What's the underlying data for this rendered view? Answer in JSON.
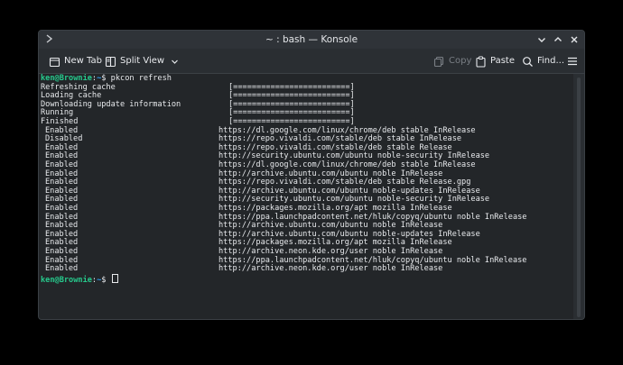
{
  "window": {
    "title": "~ : bash — Konsole"
  },
  "toolbar": {
    "new_tab_label": "New Tab",
    "split_view_label": "Split View",
    "copy_label": "Copy",
    "paste_label": "Paste",
    "find_label": "Find..."
  },
  "terminal": {
    "prompt_user": "ken@Brownie",
    "prompt_sep": ":",
    "prompt_path": "~",
    "prompt_symbol": "$",
    "command": "pkcon refresh",
    "progress_lines": [
      {
        "label": "Refreshing cache",
        "bar": "[=========================]"
      },
      {
        "label": "Loading cache",
        "bar": "[=========================]"
      },
      {
        "label": "Downloading update information",
        "bar": "[=========================]"
      },
      {
        "label": "Running",
        "bar": "[=========================]"
      },
      {
        "label": "Finished",
        "bar": "[=========================]"
      }
    ],
    "repo_lines": [
      {
        "status": "Enabled",
        "repo": "https://dl.google.com/linux/chrome/deb stable InRelease"
      },
      {
        "status": "Disabled",
        "repo": "https://repo.vivaldi.com/stable/deb stable InRelease"
      },
      {
        "status": "Enabled",
        "repo": "https://repo.vivaldi.com/stable/deb stable Release"
      },
      {
        "status": "Enabled",
        "repo": "http://security.ubuntu.com/ubuntu noble-security InRelease"
      },
      {
        "status": "Enabled",
        "repo": "https://dl.google.com/linux/chrome/deb stable InRelease"
      },
      {
        "status": "Enabled",
        "repo": "http://archive.ubuntu.com/ubuntu noble InRelease"
      },
      {
        "status": "Enabled",
        "repo": "https://repo.vivaldi.com/stable/deb stable Release.gpg"
      },
      {
        "status": "Enabled",
        "repo": "http://archive.ubuntu.com/ubuntu noble-updates InRelease"
      },
      {
        "status": "Enabled",
        "repo": "http://security.ubuntu.com/ubuntu noble-security InRelease"
      },
      {
        "status": "Enabled",
        "repo": "https://packages.mozilla.org/apt mozilla InRelease"
      },
      {
        "status": "Enabled",
        "repo": "https://ppa.launchpadcontent.net/hluk/copyq/ubuntu noble InRelease"
      },
      {
        "status": "Enabled",
        "repo": "http://archive.ubuntu.com/ubuntu noble InRelease"
      },
      {
        "status": "Enabled",
        "repo": "http://archive.ubuntu.com/ubuntu noble-updates InRelease"
      },
      {
        "status": "Enabled",
        "repo": "https://packages.mozilla.org/apt mozilla InRelease"
      },
      {
        "status": "Enabled",
        "repo": "http://archive.neon.kde.org/user noble InRelease"
      },
      {
        "status": "Enabled",
        "repo": "https://ppa.launchpadcontent.net/hluk/copyq/ubuntu noble InRelease"
      },
      {
        "status": "Enabled",
        "repo": "http://archive.neon.kde.org/user noble InRelease"
      }
    ]
  },
  "colors": {
    "prompt_user": "#26c98c",
    "prompt_path": "#2f9ff0",
    "terminal_bg": "#232629",
    "window_bg": "#2a2e32"
  },
  "icons": {
    "title_left": "chevron-right-icon",
    "new_tab": "new-tab-icon",
    "split_view": "split-view-icon",
    "split_menu": "chevron-down-icon",
    "copy": "copy-icon",
    "paste": "paste-icon",
    "find": "search-icon",
    "menu": "hamburger-menu-icon",
    "minimize": "chevron-down-icon",
    "maximize": "chevron-up-icon",
    "close": "close-icon"
  }
}
